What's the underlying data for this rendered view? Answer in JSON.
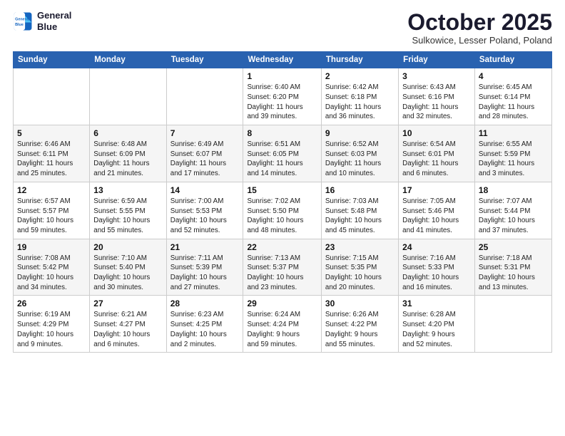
{
  "logo": {
    "line1": "General",
    "line2": "Blue"
  },
  "header": {
    "month": "October 2025",
    "location": "Sulkowice, Lesser Poland, Poland"
  },
  "weekdays": [
    "Sunday",
    "Monday",
    "Tuesday",
    "Wednesday",
    "Thursday",
    "Friday",
    "Saturday"
  ],
  "weeks": [
    [
      {
        "day": "",
        "info": ""
      },
      {
        "day": "",
        "info": ""
      },
      {
        "day": "",
        "info": ""
      },
      {
        "day": "1",
        "info": "Sunrise: 6:40 AM\nSunset: 6:20 PM\nDaylight: 11 hours\nand 39 minutes."
      },
      {
        "day": "2",
        "info": "Sunrise: 6:42 AM\nSunset: 6:18 PM\nDaylight: 11 hours\nand 36 minutes."
      },
      {
        "day": "3",
        "info": "Sunrise: 6:43 AM\nSunset: 6:16 PM\nDaylight: 11 hours\nand 32 minutes."
      },
      {
        "day": "4",
        "info": "Sunrise: 6:45 AM\nSunset: 6:14 PM\nDaylight: 11 hours\nand 28 minutes."
      }
    ],
    [
      {
        "day": "5",
        "info": "Sunrise: 6:46 AM\nSunset: 6:11 PM\nDaylight: 11 hours\nand 25 minutes."
      },
      {
        "day": "6",
        "info": "Sunrise: 6:48 AM\nSunset: 6:09 PM\nDaylight: 11 hours\nand 21 minutes."
      },
      {
        "day": "7",
        "info": "Sunrise: 6:49 AM\nSunset: 6:07 PM\nDaylight: 11 hours\nand 17 minutes."
      },
      {
        "day": "8",
        "info": "Sunrise: 6:51 AM\nSunset: 6:05 PM\nDaylight: 11 hours\nand 14 minutes."
      },
      {
        "day": "9",
        "info": "Sunrise: 6:52 AM\nSunset: 6:03 PM\nDaylight: 11 hours\nand 10 minutes."
      },
      {
        "day": "10",
        "info": "Sunrise: 6:54 AM\nSunset: 6:01 PM\nDaylight: 11 hours\nand 6 minutes."
      },
      {
        "day": "11",
        "info": "Sunrise: 6:55 AM\nSunset: 5:59 PM\nDaylight: 11 hours\nand 3 minutes."
      }
    ],
    [
      {
        "day": "12",
        "info": "Sunrise: 6:57 AM\nSunset: 5:57 PM\nDaylight: 10 hours\nand 59 minutes."
      },
      {
        "day": "13",
        "info": "Sunrise: 6:59 AM\nSunset: 5:55 PM\nDaylight: 10 hours\nand 55 minutes."
      },
      {
        "day": "14",
        "info": "Sunrise: 7:00 AM\nSunset: 5:53 PM\nDaylight: 10 hours\nand 52 minutes."
      },
      {
        "day": "15",
        "info": "Sunrise: 7:02 AM\nSunset: 5:50 PM\nDaylight: 10 hours\nand 48 minutes."
      },
      {
        "day": "16",
        "info": "Sunrise: 7:03 AM\nSunset: 5:48 PM\nDaylight: 10 hours\nand 45 minutes."
      },
      {
        "day": "17",
        "info": "Sunrise: 7:05 AM\nSunset: 5:46 PM\nDaylight: 10 hours\nand 41 minutes."
      },
      {
        "day": "18",
        "info": "Sunrise: 7:07 AM\nSunset: 5:44 PM\nDaylight: 10 hours\nand 37 minutes."
      }
    ],
    [
      {
        "day": "19",
        "info": "Sunrise: 7:08 AM\nSunset: 5:42 PM\nDaylight: 10 hours\nand 34 minutes."
      },
      {
        "day": "20",
        "info": "Sunrise: 7:10 AM\nSunset: 5:40 PM\nDaylight: 10 hours\nand 30 minutes."
      },
      {
        "day": "21",
        "info": "Sunrise: 7:11 AM\nSunset: 5:39 PM\nDaylight: 10 hours\nand 27 minutes."
      },
      {
        "day": "22",
        "info": "Sunrise: 7:13 AM\nSunset: 5:37 PM\nDaylight: 10 hours\nand 23 minutes."
      },
      {
        "day": "23",
        "info": "Sunrise: 7:15 AM\nSunset: 5:35 PM\nDaylight: 10 hours\nand 20 minutes."
      },
      {
        "day": "24",
        "info": "Sunrise: 7:16 AM\nSunset: 5:33 PM\nDaylight: 10 hours\nand 16 minutes."
      },
      {
        "day": "25",
        "info": "Sunrise: 7:18 AM\nSunset: 5:31 PM\nDaylight: 10 hours\nand 13 minutes."
      }
    ],
    [
      {
        "day": "26",
        "info": "Sunrise: 6:19 AM\nSunset: 4:29 PM\nDaylight: 10 hours\nand 9 minutes."
      },
      {
        "day": "27",
        "info": "Sunrise: 6:21 AM\nSunset: 4:27 PM\nDaylight: 10 hours\nand 6 minutes."
      },
      {
        "day": "28",
        "info": "Sunrise: 6:23 AM\nSunset: 4:25 PM\nDaylight: 10 hours\nand 2 minutes."
      },
      {
        "day": "29",
        "info": "Sunrise: 6:24 AM\nSunset: 4:24 PM\nDaylight: 9 hours\nand 59 minutes."
      },
      {
        "day": "30",
        "info": "Sunrise: 6:26 AM\nSunset: 4:22 PM\nDaylight: 9 hours\nand 55 minutes."
      },
      {
        "day": "31",
        "info": "Sunrise: 6:28 AM\nSunset: 4:20 PM\nDaylight: 9 hours\nand 52 minutes."
      },
      {
        "day": "",
        "info": ""
      }
    ]
  ]
}
